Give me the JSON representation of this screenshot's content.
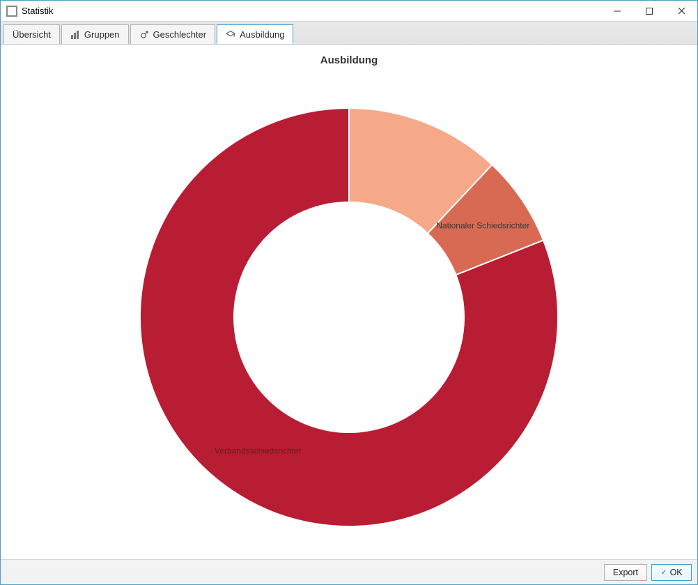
{
  "window": {
    "title": "Statistik"
  },
  "tabs": [
    {
      "label": "Übersicht",
      "icon": "none"
    },
    {
      "label": "Gruppen",
      "icon": "bar-chart-icon"
    },
    {
      "label": "Geschlechter",
      "icon": "gender-icon"
    },
    {
      "label": "Ausbildung",
      "icon": "grad-cap-icon",
      "active": true
    }
  ],
  "chart_title": "Ausbildung",
  "chart_data": {
    "type": "pie",
    "title": "Ausbildung",
    "series": [
      {
        "name": "",
        "value": 12,
        "color": "#f6a988"
      },
      {
        "name": "Nationaler Schiedsrichter",
        "value": 7,
        "color": "#d86a53"
      },
      {
        "name": "Verbandsschiedsrichter",
        "value": 81,
        "color": "#b91d33"
      }
    ],
    "inner_radius_ratio": 0.55
  },
  "buttons": {
    "export": "Export",
    "ok": "OK"
  }
}
